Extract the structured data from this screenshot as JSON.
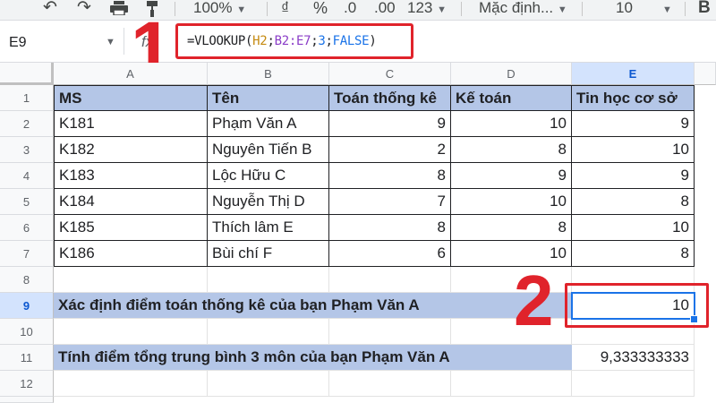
{
  "toolbar": {
    "zoom": "100%",
    "currency_symbol": "₫",
    "percent_symbol": "%",
    "decrease_decimal": ".0",
    "increase_decimal": ".00",
    "number_format": "123",
    "font_name": "Mặc định...",
    "font_size": "10",
    "bold": "B"
  },
  "formula_bar": {
    "name_box": "E9",
    "fx": "fx",
    "formula_prefix": "=VLOOKUP(",
    "formula_arg1": "H2",
    "sep1": ";",
    "formula_arg2": "B2:E7",
    "sep2": ";",
    "formula_arg3": "3",
    "sep3": ";",
    "formula_arg4": "FALSE",
    "formula_suffix": ")"
  },
  "annotations": {
    "step1": "1",
    "step2": "2"
  },
  "columns": [
    "A",
    "B",
    "C",
    "D",
    "E"
  ],
  "rows": [
    "1",
    "2",
    "3",
    "4",
    "5",
    "6",
    "7",
    "8",
    "9",
    "10",
    "11",
    "12"
  ],
  "table": {
    "headers": [
      "MS",
      "Tên",
      "Toán thống kê",
      "Kế toán",
      "Tin học cơ sở"
    ],
    "rows": [
      [
        "K181",
        "Phạm Văn A",
        "9",
        "10",
        "9"
      ],
      [
        "K182",
        "Nguyên Tiến B",
        "2",
        "8",
        "10"
      ],
      [
        "K183",
        "Lộc Hữu C",
        "8",
        "9",
        "9"
      ],
      [
        "K184",
        "Nguyễn Thị D",
        "7",
        "10",
        "8"
      ],
      [
        "K185",
        "Thích lâm E",
        "8",
        "8",
        "10"
      ],
      [
        "K186",
        "Bùi chí F",
        "6",
        "10",
        "8"
      ]
    ]
  },
  "row9": {
    "label": "Xác định điểm toán thống kê của bạn Phạm Văn A",
    "value": "10"
  },
  "row11": {
    "label": "Tính điểm tổng trung bình 3 môn của bạn Phạm Văn A",
    "value": "9,333333333"
  },
  "colors": {
    "header_fill": "#b4c6e7",
    "annotation_red": "#e0232b",
    "selection_blue": "#1a73e8"
  }
}
